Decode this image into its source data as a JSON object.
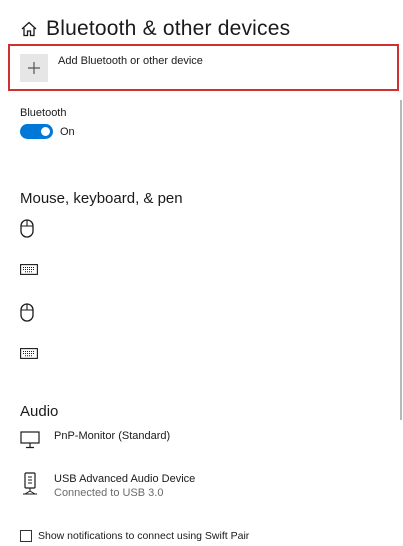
{
  "header": {
    "title": "Bluetooth & other devices",
    "icon": "home-icon"
  },
  "add_device": {
    "label": "Add Bluetooth or other device",
    "icon": "plus-icon"
  },
  "bluetooth": {
    "label": "Bluetooth",
    "toggle_state": "On",
    "accent": "#0078d7"
  },
  "mouse_section": {
    "heading": "Mouse, keyboard, & pen",
    "devices": [
      {
        "icon": "mouse-icon"
      },
      {
        "icon": "keyboard-icon"
      },
      {
        "icon": "mouse-icon"
      },
      {
        "icon": "keyboard-icon"
      }
    ]
  },
  "audio_section": {
    "heading": "Audio",
    "devices": [
      {
        "icon": "monitor-icon",
        "name": "PnP-Monitor (Standard)",
        "status": ""
      },
      {
        "icon": "speaker-icon",
        "name": "USB Advanced Audio Device",
        "status": "Connected to USB 3.0"
      }
    ]
  },
  "swift_pair": {
    "label": "Show notifications to connect using Swift Pair",
    "checked": false
  },
  "colors": {
    "highlight_border": "#d0302f"
  }
}
